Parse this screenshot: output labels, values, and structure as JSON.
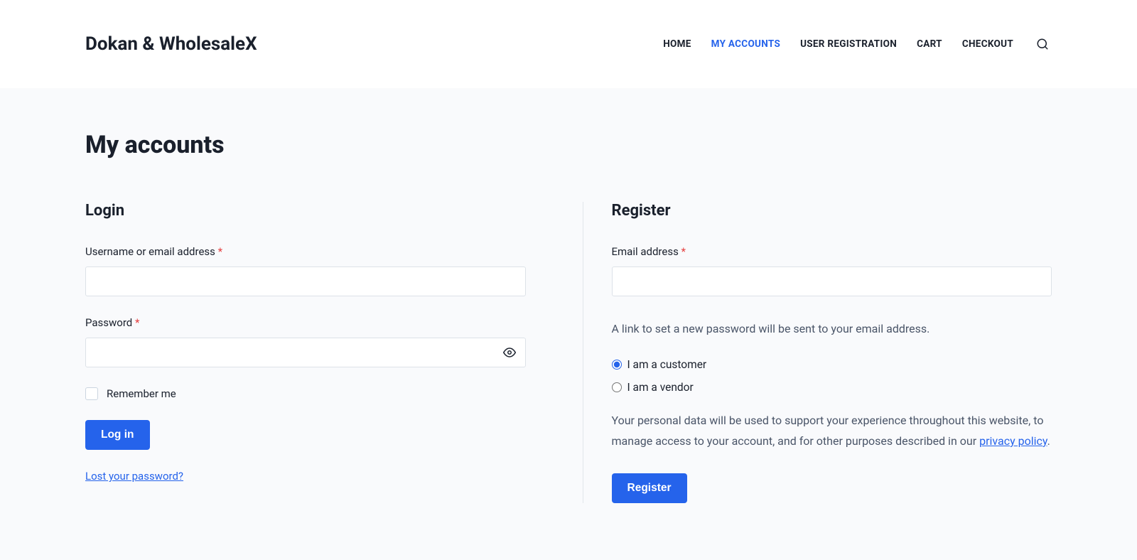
{
  "header": {
    "site_title": "Dokan & WholesaleX",
    "nav": {
      "home": "HOME",
      "my_accounts": "MY ACCOUNTS",
      "user_registration": "USER REGISTRATION",
      "cart": "CART",
      "checkout": "CHECKOUT"
    }
  },
  "page": {
    "title": "My accounts"
  },
  "login": {
    "heading": "Login",
    "username_label": "Username or email address ",
    "password_label": "Password ",
    "remember_label": "Remember me",
    "submit_label": "Log in",
    "lost_password_link": "Lost your password?",
    "required_mark": "*"
  },
  "register": {
    "heading": "Register",
    "email_label": "Email address ",
    "required_mark": "*",
    "info_text": "A link to set a new password will be sent to your email address.",
    "role_customer": "I am a customer",
    "role_vendor": "I am a vendor",
    "privacy_text_1": "Your personal data will be used to support your experience throughout this website, to manage access to your account, and for other purposes described in our ",
    "privacy_link": "privacy policy",
    "privacy_text_2": ".",
    "submit_label": "Register"
  }
}
